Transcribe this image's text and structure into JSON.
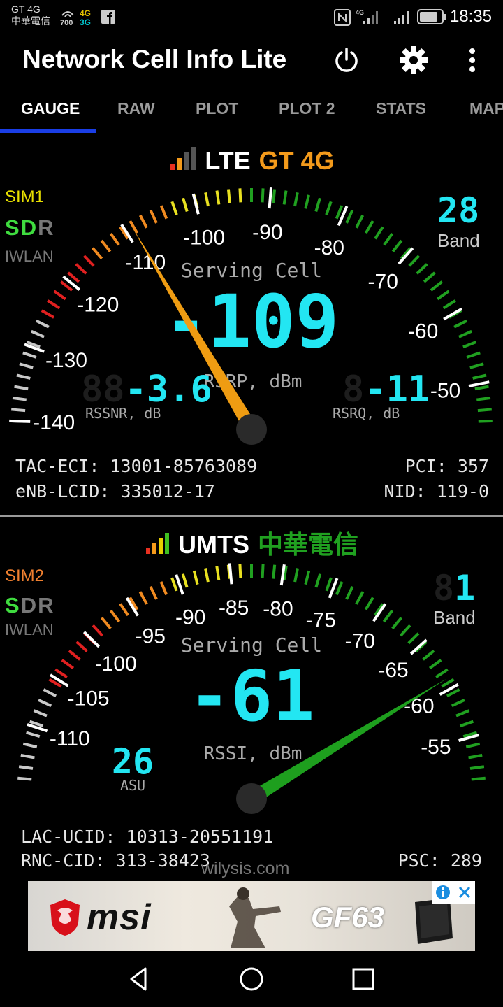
{
  "status_bar": {
    "carrier_line1": "GT 4G",
    "carrier_line2": "中華電信",
    "hotspot_speed": "700",
    "net_4g": "4G",
    "net_3g": "3G",
    "signal_label": "4G",
    "battery_icon": "battery-icon",
    "time": "18:35"
  },
  "app": {
    "title": "Network Cell Info Lite",
    "icons": [
      "power-icon",
      "gear-icon",
      "more-vert-icon"
    ]
  },
  "tabs": [
    {
      "label": "GAUGE"
    },
    {
      "label": "RAW"
    },
    {
      "label": "PLOT"
    },
    {
      "label": "PLOT 2"
    },
    {
      "label": "STATS"
    },
    {
      "label": "MAP"
    }
  ],
  "sim1": {
    "tech": "LTE",
    "operator": "GT 4G",
    "operator_color": "#f39a1b",
    "sim_label": "SIM1",
    "sim_color": "#e8e000",
    "sdr": {
      "s": "S",
      "d": "D",
      "r": "R"
    },
    "sdr_state": {
      "s": "on",
      "d": "on",
      "r": "off"
    },
    "iwlan": "IWLAN",
    "band": "28",
    "band_label": "Band",
    "serving_label": "Serving Cell",
    "main_value": "-109",
    "main_value_numeric": -109,
    "main_unit": "RSRP, dBm",
    "snr_value": "-3.6",
    "snr_label": "RSSNR, dB",
    "rsrq_value": "-11",
    "rsrq_label": "RSRQ, dB",
    "needle_color": "#ef9c12",
    "scale_min": -140,
    "scale_max": -45,
    "ticks": [
      -140,
      -130,
      -120,
      -110,
      -100,
      -90,
      -80,
      -70,
      -60,
      -50
    ],
    "tac_eci": "TAC-ECI: 13001-85763089",
    "pci": "PCI: 357",
    "enb_lcid": "eNB-LCID: 335012-17",
    "nid": "NID: 119-0"
  },
  "sim2": {
    "tech": "UMTS",
    "operator": "中華電信",
    "operator_color": "#20a020",
    "sim_label": "SIM2",
    "sim_color": "#f08030",
    "sdr": {
      "s": "S",
      "d": "D",
      "r": "R"
    },
    "sdr_state": {
      "s": "on",
      "d": "off",
      "r": "off"
    },
    "iwlan": "IWLAN",
    "band": "1",
    "band_label": "Band",
    "serving_label": "Serving Cell",
    "main_value": "-61",
    "main_value_numeric": -61,
    "main_unit": "RSSI, dBm",
    "asu_value": "26",
    "asu_label": "ASU",
    "needle_color": "#1e9f1e",
    "scale_min": -115,
    "scale_max": -51,
    "ticks": [
      -110,
      -105,
      -100,
      -95,
      -90,
      -85,
      -80,
      -75,
      -70,
      -65,
      -60,
      -55
    ],
    "lac_ucid": "LAC-UCID: 10313-20551191",
    "rnc_cid": "RNC-CID: 313-38423",
    "psc": "PSC: 289"
  },
  "watermark": "wilysis.com",
  "ad": {
    "brand": "msi",
    "model": "GF63",
    "icons": [
      "info-icon",
      "close-icon"
    ]
  },
  "nav": [
    "back-icon",
    "home-icon",
    "recents-icon"
  ]
}
